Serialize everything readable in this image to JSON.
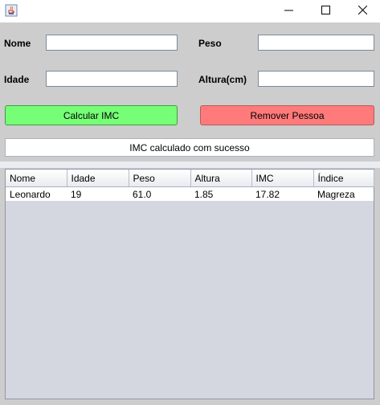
{
  "window": {
    "app_icon": "java-cup-icon",
    "controls": [
      "minimize-icon",
      "maximize-icon",
      "close-icon"
    ]
  },
  "form": {
    "nome_label": "Nome",
    "nome_value": "",
    "peso_label": "Peso",
    "peso_value": "",
    "idade_label": "Idade",
    "idade_value": "",
    "altura_label": "Altura(cm)",
    "altura_value": ""
  },
  "buttons": {
    "calcular_label": "Calcular IMC",
    "remover_label": "Remover Pessoa",
    "calcular_color": "#76ff76",
    "remover_color": "#ff7a7a"
  },
  "status": {
    "message": "IMC calculado com sucesso"
  },
  "table": {
    "columns": [
      "Nome",
      "Idade",
      "Peso",
      "Altura",
      "IMC",
      "Índice"
    ],
    "rows": [
      [
        "Leonardo",
        "19",
        "61.0",
        "1.85",
        "17.82",
        "Magreza"
      ]
    ]
  }
}
